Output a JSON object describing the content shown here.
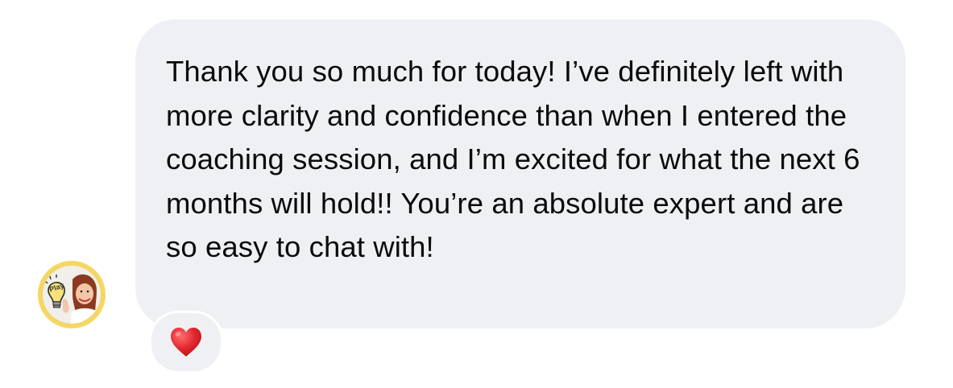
{
  "message": {
    "text": "Thank you so much for today! I’ve definitely left with more clarity and confidence than when I entered the coaching session, and I’m excited for what the next 6 months will hold!! You’re an absolute expert and are so easy to chat with!"
  },
  "avatar": {
    "badge_text": "Play"
  },
  "reaction": {
    "emoji_name": "red-heart-icon"
  },
  "colors": {
    "bubble_background": "#eff0f3",
    "text": "#0b0b0c",
    "avatar_ring": "#f3d567",
    "heart": "#e0262e"
  }
}
